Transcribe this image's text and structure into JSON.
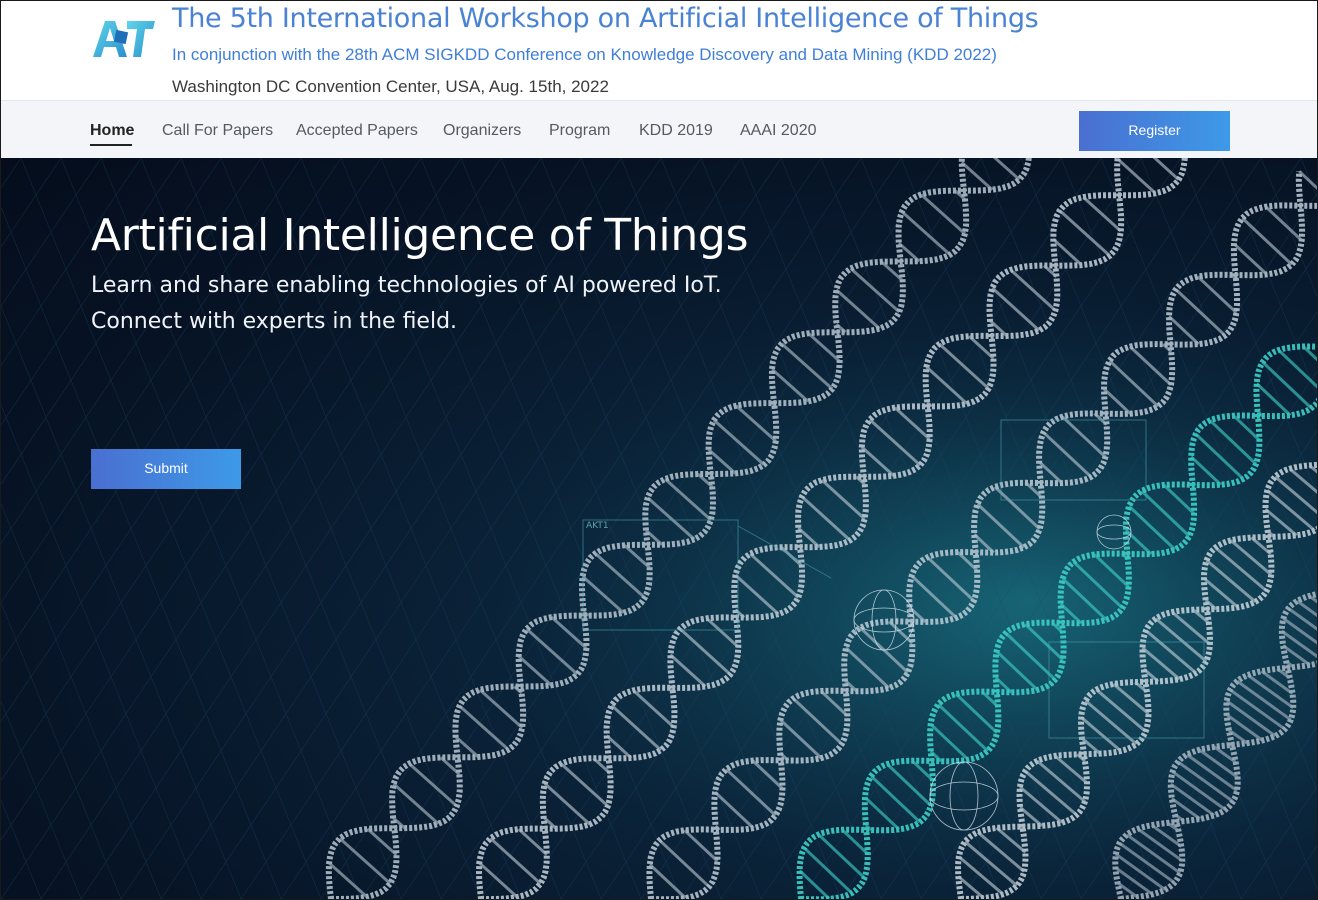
{
  "header": {
    "logo_text": "AIoT",
    "title": "The 5th International Workshop on Artificial Intelligence of Things",
    "subtitle": "In conjunction with the 28th ACM SIGKDD Conference on Knowledge Discovery and Data Mining (KDD 2022)",
    "venue": "Washington DC Convention Center, USA, Aug. 15th, 2022"
  },
  "nav": {
    "items": [
      {
        "label": "Home",
        "active": true
      },
      {
        "label": "Call For Papers"
      },
      {
        "label": "Accepted Papers"
      },
      {
        "label": "Organizers"
      },
      {
        "label": "Program"
      },
      {
        "label": "KDD 2019"
      },
      {
        "label": "AAAI 2020"
      }
    ],
    "register_label": "Register"
  },
  "hero": {
    "title": "Artificial Intelligence of Things",
    "line1": "Learn and share enabling technologies of AI powered IoT.",
    "line2": "Connect with experts in the field.",
    "submit_label": "Submit",
    "hud_label": "AKT1"
  },
  "colors": {
    "title_blue": "#4a82d4",
    "button_start": "#4a6fd0",
    "button_end": "#3d9ae8",
    "hero_bg": "#071426",
    "dna_teal": "#3fd0c8"
  },
  "icons": {
    "logo": "aiot-logo-icon"
  }
}
